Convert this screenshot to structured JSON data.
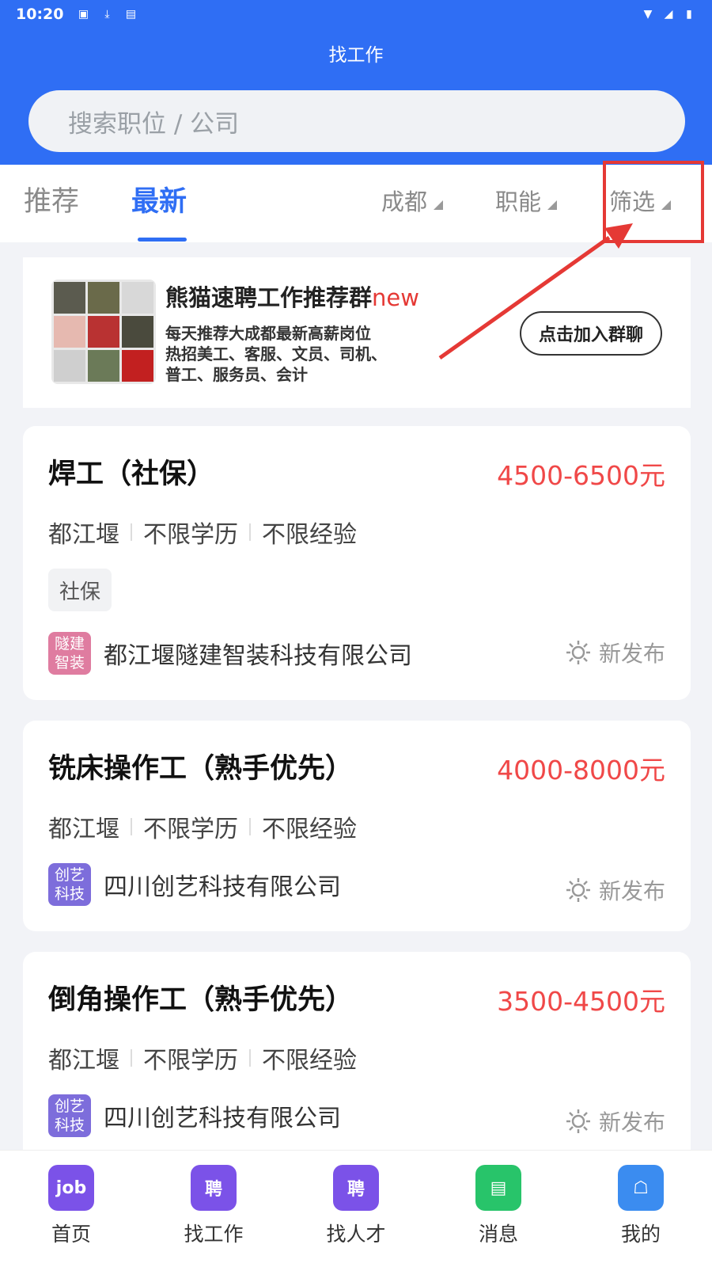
{
  "status_bar": {
    "time": "10:20"
  },
  "header": {
    "title": "找工作"
  },
  "search": {
    "placeholder": "搜索职位 / 公司"
  },
  "tabs": {
    "recommend": "推荐",
    "latest": "最新"
  },
  "filters": {
    "city": "成都",
    "function": "职能",
    "filter": "筛选"
  },
  "banner": {
    "title": "熊猫速聘工作推荐群",
    "badge": "new",
    "line1": "每天推荐大成都最新高薪岗位",
    "line2": "热招美工、客服、文员、司机、",
    "line3": "普工、服务员、会计",
    "button": "点击加入群聊"
  },
  "jobs": [
    {
      "title": "焊工（社保）",
      "salary": "4500-6500元",
      "location": "都江堰",
      "education": "不限学历",
      "experience": "不限经验",
      "tag": "社保",
      "company_logo_text": "隧建智装",
      "company": "都江堰隧建智装科技有限公司",
      "status": "新发布"
    },
    {
      "title": "铣床操作工（熟手优先）",
      "salary": "4000-8000元",
      "location": "都江堰",
      "education": "不限学历",
      "experience": "不限经验",
      "company_logo_text": "创艺科技",
      "company": "四川创艺科技有限公司",
      "status": "新发布"
    },
    {
      "title": "倒角操作工（熟手优先）",
      "salary": "3500-4500元",
      "location": "都江堰",
      "education": "不限学历",
      "experience": "不限经验",
      "company_logo_text": "创艺科技",
      "company": "四川创艺科技有限公司",
      "status": "新发布"
    }
  ],
  "bottom_nav": {
    "home": "首页",
    "find_job": "找工作",
    "find_talent": "找人才",
    "messages": "消息",
    "mine": "我的",
    "job_icon_text": "job",
    "hire_icon_text": "聘"
  },
  "colors": {
    "primary": "#2f6ef4",
    "salary": "#f04848",
    "highlight": "#e53935"
  }
}
